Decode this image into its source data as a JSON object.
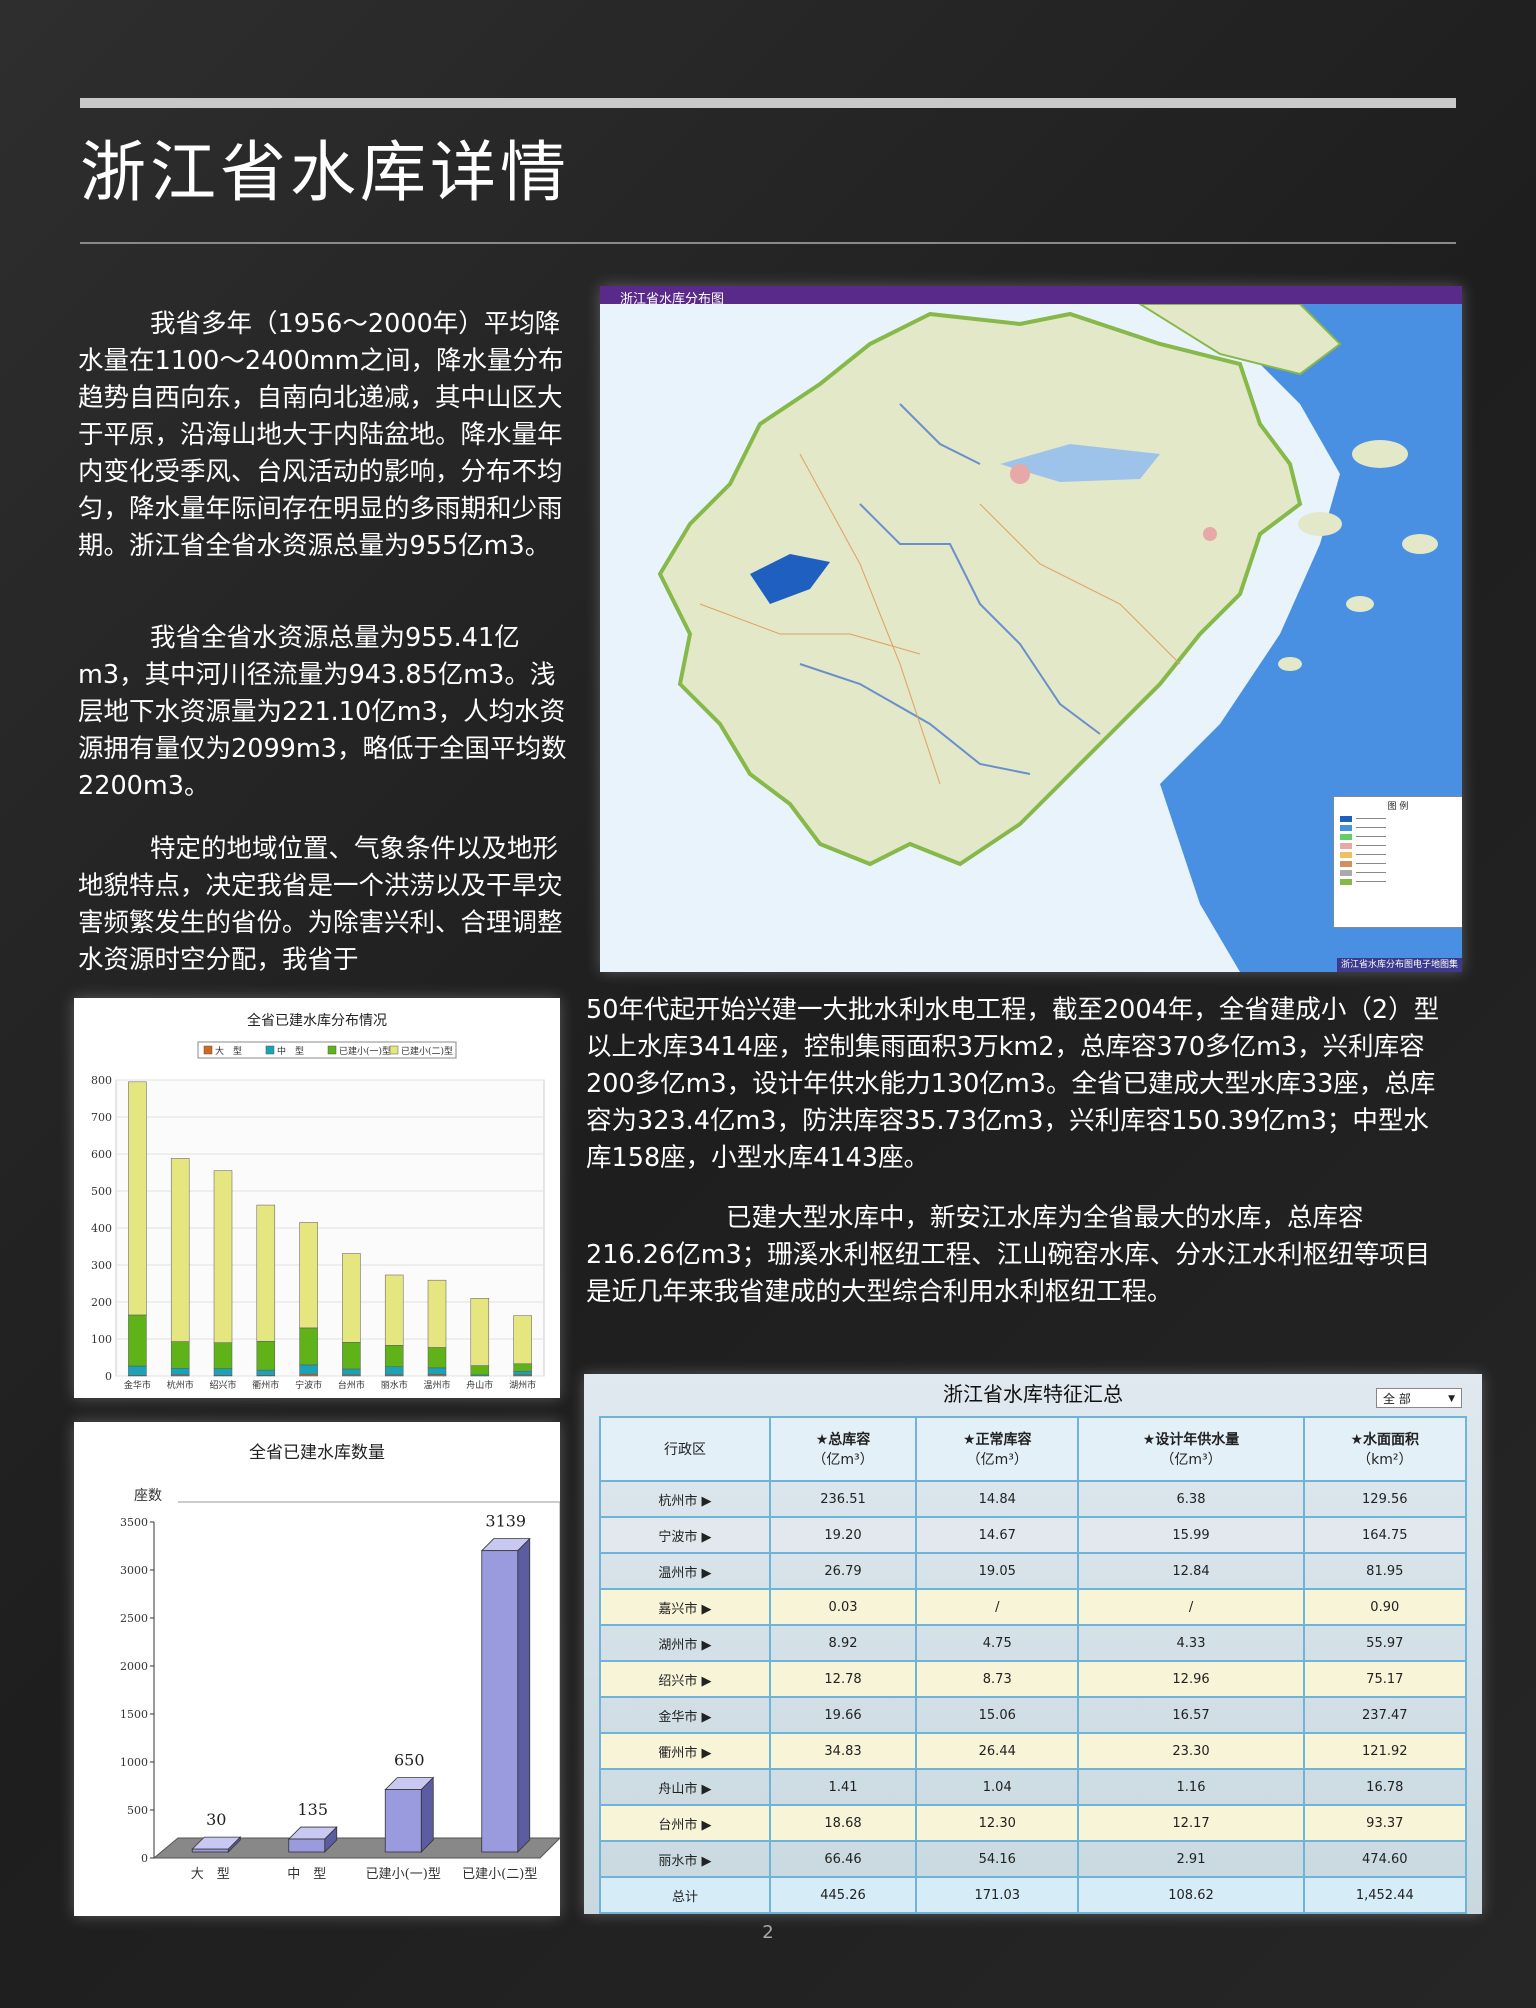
{
  "page": {
    "title": "浙江省水库详情",
    "page_number": "2"
  },
  "text": {
    "p1": "我省多年（1956～2000年）平均降水量在1100～2400mm之间，降水量分布趋势自西向东，自南向北递减，其中山区大于平原，沿海山地大于内陆盆地。降水量年内变化受季风、台风活动的影响，分布不均匀，降水量年际间存在明显的多雨期和少雨期。浙江省全省水资源总量为955亿m3。",
    "p2": "我省全省水资源总量为955.41亿m3，其中河川径流量为943.85亿m3。浅层地下水资源量为221.10亿m3，人均水资源拥有量仅为2099m3，略低于全国平均数2200m3。",
    "p3a": "特定的地域位置、气象条件以及地形地貌特点，决定我省是一个洪涝以及干旱灾害频繁发生的省份。为除害兴利、合理调整水资源时空分配，我省于",
    "p3b": "50年代起开始兴建一大批水利水电工程，截至2004年，全省建成小（2）型以上水库3414座，控制集雨面积3万km2，总库容370多亿m3，兴利库容200多亿m3，设计年供水能力130亿m3。全省已建成大型水库33座，总库容为323.4亿m3，防洪库容35.73亿m3，兴利库容150.39亿m3；中型水库158座，小型水库4143座。",
    "p4": "已建大型水库中，新安江水库为全省最大的水库，总库容216.26亿m3；珊溪水利枢纽工程、江山碗窑水库、分水江水利枢纽等项目是近几年来我省建成的大型综合利用水利枢纽工程。"
  },
  "map": {
    "title": "浙江省水库分布图",
    "footer": "浙江省水库分布图电子地图集",
    "legend_title": "图 例",
    "colors": {
      "sea": "#4a90e2",
      "land": "#e8eccf",
      "lake": "#1f5fc0",
      "border": "#86b84a"
    }
  },
  "chart_data": [
    {
      "type": "bar",
      "stacked": true,
      "title": "全省已建水库分布情况",
      "categories": [
        "金华市",
        "杭州市",
        "绍兴市",
        "衢州市",
        "宁波市",
        "台州市",
        "丽水市",
        "温州市",
        "舟山市",
        "湖州市"
      ],
      "legend": [
        "大　型",
        "中　型",
        "已建小(一)型",
        "已建小(二)型"
      ],
      "colors": [
        "#d2691e",
        "#1aa3b8",
        "#5fb319",
        "#e6e680"
      ],
      "series": [
        {
          "name": "大　型",
          "values": [
            2,
            3,
            2,
            2,
            5,
            3,
            3,
            4,
            0,
            3
          ]
        },
        {
          "name": "中　型",
          "values": [
            25,
            18,
            18,
            14,
            25,
            16,
            22,
            18,
            3,
            10
          ]
        },
        {
          "name": "已建小(一)型",
          "values": [
            138,
            72,
            70,
            78,
            100,
            72,
            58,
            55,
            25,
            20
          ]
        },
        {
          "name": "已建小(二)型",
          "values": [
            630,
            495,
            465,
            368,
            285,
            240,
            190,
            182,
            182,
            130
          ]
        }
      ],
      "ylim": [
        0,
        800
      ],
      "yticks": [
        "0",
        "100",
        "200",
        "300",
        "400",
        "500",
        "600",
        "700",
        "800"
      ]
    },
    {
      "type": "bar",
      "title": "全省已建水库数量",
      "ylabel": "座数",
      "categories": [
        "大　型",
        "中　型",
        "已建小(一)型",
        "已建小(二)型"
      ],
      "values": [
        30,
        135,
        650,
        3139
      ],
      "value_labels": [
        "30",
        "135",
        "650",
        "3139"
      ],
      "ylim": [
        0,
        3500
      ],
      "yticks": [
        "0",
        "500",
        "1000",
        "1500",
        "2000",
        "2500",
        "3000",
        "3500"
      ],
      "color": "#9a9ade"
    }
  ],
  "table": {
    "title": "浙江省水库特征汇总",
    "dropdown": "全 部",
    "headers": [
      {
        "name": "行政区",
        "unit": ""
      },
      {
        "name": "★总库容",
        "unit": "（亿m³）"
      },
      {
        "name": "★正常库容",
        "unit": "（亿m³）"
      },
      {
        "name": "★设计年供水量",
        "unit": "（亿m³）"
      },
      {
        "name": "★水面面积",
        "unit": "（km²）"
      }
    ],
    "rows": [
      [
        "杭州市 ▶",
        "236.51",
        "14.84",
        "6.38",
        "129.56"
      ],
      [
        "宁波市 ▶",
        "19.20",
        "14.67",
        "15.99",
        "164.75"
      ],
      [
        "温州市 ▶",
        "26.79",
        "19.05",
        "12.84",
        "81.95"
      ],
      [
        "嘉兴市 ▶",
        "0.03",
        "/",
        "/",
        "0.90"
      ],
      [
        "湖州市 ▶",
        "8.92",
        "4.75",
        "4.33",
        "55.97"
      ],
      [
        "绍兴市 ▶",
        "12.78",
        "8.73",
        "12.96",
        "75.17"
      ],
      [
        "金华市 ▶",
        "19.66",
        "15.06",
        "16.57",
        "237.47"
      ],
      [
        "衢州市 ▶",
        "34.83",
        "26.44",
        "23.30",
        "121.92"
      ],
      [
        "舟山市 ▶",
        "1.41",
        "1.04",
        "1.16",
        "16.78"
      ],
      [
        "台州市 ▶",
        "18.68",
        "12.30",
        "12.17",
        "93.37"
      ],
      [
        "丽水市 ▶",
        "66.46",
        "54.16",
        "2.91",
        "474.60"
      ]
    ],
    "total": [
      "总计",
      "445.26",
      "171.03",
      "108.62",
      "1,452.44"
    ]
  }
}
